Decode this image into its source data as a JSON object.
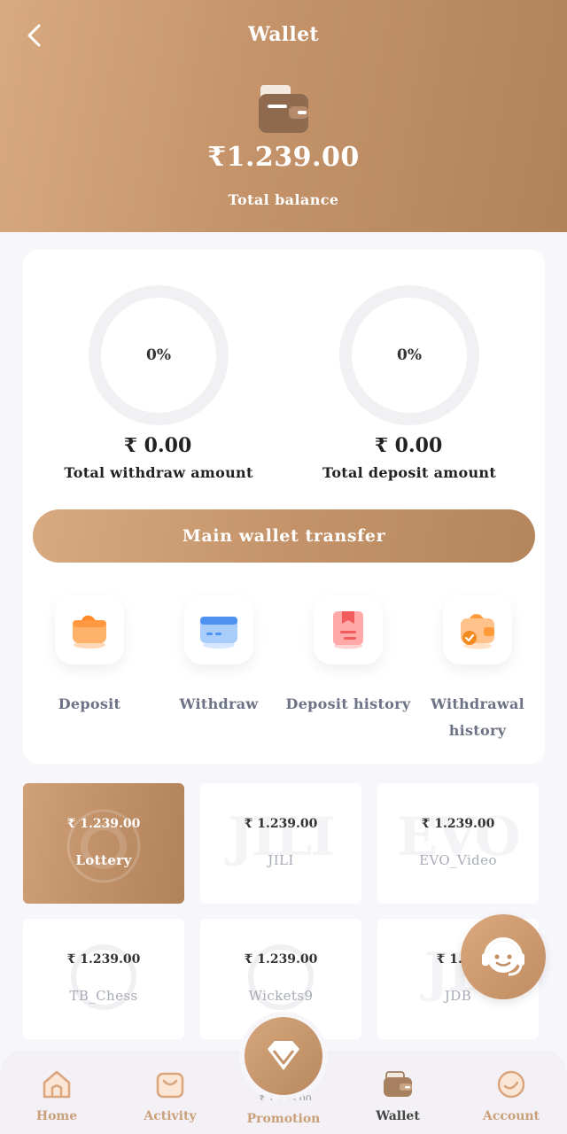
{
  "header": {
    "title": "Wallet",
    "balance": "₹1.239.00",
    "balance_label": "Total balance"
  },
  "stats": {
    "withdraw": {
      "percent_text": "0%",
      "percent": 0,
      "amount": "₹ 0.00",
      "label": "Total withdraw amount"
    },
    "deposit": {
      "percent_text": "0%",
      "percent": 0,
      "amount": "₹ 0.00",
      "label": "Total deposit amount"
    }
  },
  "transfer_button": "Main wallet transfer",
  "actions": [
    {
      "label": "Deposit",
      "icon": "wallet-deposit-icon"
    },
    {
      "label": "Withdraw",
      "icon": "card-withdraw-icon"
    },
    {
      "label": "Deposit history",
      "icon": "deposit-history-icon"
    },
    {
      "label": "Withdrawal history",
      "icon": "withdrawal-history-icon"
    }
  ],
  "games": [
    {
      "amount": "₹ 1.239.00",
      "name": "Lottery",
      "active": true
    },
    {
      "amount": "₹ 1.239.00",
      "name": "JILI",
      "active": false
    },
    {
      "amount": "₹ 1.239.00",
      "name": "EVO_Video",
      "active": false
    },
    {
      "amount": "₹ 1.239.00",
      "name": "TB_Chess",
      "active": false
    },
    {
      "amount": "₹ 1.239.00",
      "name": "Wickets9",
      "active": false
    },
    {
      "amount": "₹ 1.23",
      "name": "JDB",
      "active": false
    }
  ],
  "peek_amount": "₹ 1.239.00",
  "nav": {
    "home": "Home",
    "activity": "Activity",
    "promotion": "Promotion",
    "wallet": "Wallet",
    "account": "Account"
  },
  "colors": {
    "accent": "#c4936a",
    "nav_inactive": "#c9a07a",
    "background": "#f6f6fb"
  }
}
